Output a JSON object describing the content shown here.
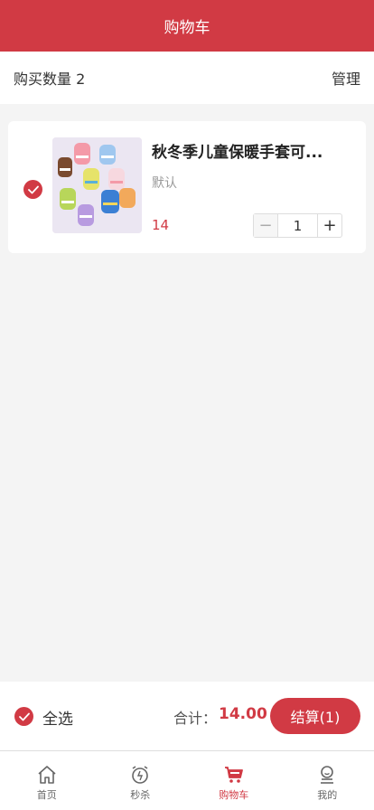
{
  "header": {
    "title": "购物车"
  },
  "subbar": {
    "count_label": "购买数量 2",
    "manage_label": "管理"
  },
  "cart": {
    "items": [
      {
        "title": "秋冬季儿童保暖手套可...",
        "spec": "默认",
        "price": "14",
        "quantity": "1",
        "selected": true,
        "minus_symbol": "−",
        "plus_symbol": "+"
      }
    ]
  },
  "footer": {
    "select_all_label": "全选",
    "total_label": "合计：",
    "total_value": "14.00",
    "checkout_label": "结算(1)"
  },
  "tabbar": {
    "tabs": [
      {
        "label": "首页",
        "icon": "home-icon",
        "active": false
      },
      {
        "label": "秒杀",
        "icon": "alarm-clock-icon",
        "active": false
      },
      {
        "label": "购物车",
        "icon": "cart-icon",
        "active": true
      },
      {
        "label": "我的",
        "icon": "user-icon",
        "active": false
      }
    ]
  },
  "colors": {
    "accent": "#d13a44",
    "background": "#f4f4f4"
  }
}
